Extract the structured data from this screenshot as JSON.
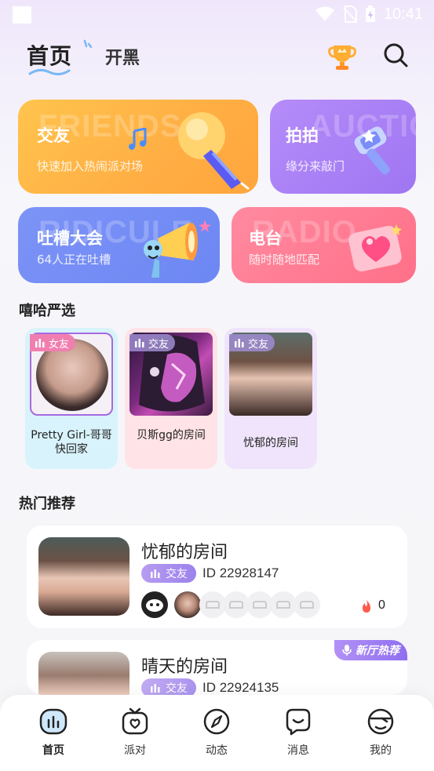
{
  "status_bar": {
    "time": "10:41"
  },
  "header": {
    "tab_home": "首页",
    "tab_kaihei": "开黑"
  },
  "features": [
    {
      "title": "交友",
      "subtitle": "快速加入热闹派对场",
      "ghost": "FRIENDS",
      "color": "#ffb347"
    },
    {
      "title": "拍拍",
      "subtitle": "缘分来敲门",
      "ghost": "AUCTION",
      "color": "#a77ef4"
    },
    {
      "title": "吐槽大会",
      "subtitle": "64人正在吐槽",
      "ghost": "RIDICULE",
      "color": "#768ef5"
    },
    {
      "title": "电台",
      "subtitle": "随时随地匹配",
      "ghost": "RADIO",
      "color": "#ff7c92"
    }
  ],
  "selection": {
    "title": "嘻哈严选",
    "rooms": [
      {
        "tag": "女友",
        "name": "Pretty Girl-哥哥快回家"
      },
      {
        "tag": "交友",
        "name": "贝斯gg的房间"
      },
      {
        "tag": "交友",
        "name": "忧郁的房间"
      }
    ]
  },
  "hot": {
    "title": "热门推荐",
    "items": [
      {
        "title": "忧郁的房间",
        "tag": "交友",
        "id": "ID 22928147",
        "fire": "0"
      },
      {
        "title": "晴天的房间",
        "tag": "交友",
        "id": "ID 22924135",
        "badge": "新厅热荐"
      }
    ]
  },
  "nav": [
    {
      "label": "首页",
      "icon": "home-icon",
      "active": true
    },
    {
      "label": "派对",
      "icon": "tv-icon"
    },
    {
      "label": "动态",
      "icon": "compass-icon"
    },
    {
      "label": "消息",
      "icon": "message-icon"
    },
    {
      "label": "我的",
      "icon": "profile-icon"
    }
  ]
}
